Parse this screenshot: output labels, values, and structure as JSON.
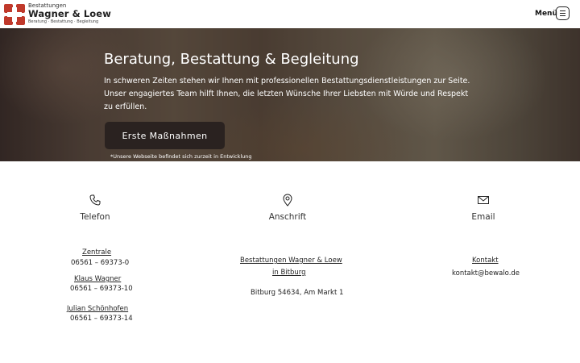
{
  "header": {
    "brand_small": "Bestattungen",
    "brand_main": "Wagner & Loew",
    "brand_tagline": "Beratung · Bestattung · Begleitung",
    "menu_label": "Menü",
    "logo_color": "#c0392b"
  },
  "hero": {
    "title": "Beratung, Bestattung & Begleitung",
    "text": "In schweren Zeiten stehen wir Ihnen mit professionellen Bestattungsdienstleistungen zur Seite. Unser engagiertes Team hilft Ihnen, die letzten Wünsche Ihrer Liebsten mit Würde und Respekt zu erfüllen.",
    "cta_label": "Erste Maßnahmen",
    "note": "*Unsere Webseite befindet sich zurzeit in Entwicklung"
  },
  "contact": {
    "phone": {
      "icon": "phone-icon",
      "title": "Telefon",
      "entries": [
        {
          "name": "Zentrale",
          "number": "06561 – 69373-0"
        },
        {
          "name": "Klaus Wagner",
          "number": "06561 – 69373-10"
        },
        {
          "name": "Julian Schönhofen",
          "number": "06561 – 69373-14"
        }
      ]
    },
    "address": {
      "icon": "map-pin-icon",
      "title": "Anschrift",
      "link_line1": "Bestattungen Wagner & Loew",
      "link_line2": "in Bitburg",
      "street": "Bitburg 54634, Am Markt 1"
    },
    "email": {
      "icon": "mail-icon",
      "title": "Email",
      "link": "Kontakt",
      "address": "kontakt@bewalo.de"
    }
  }
}
